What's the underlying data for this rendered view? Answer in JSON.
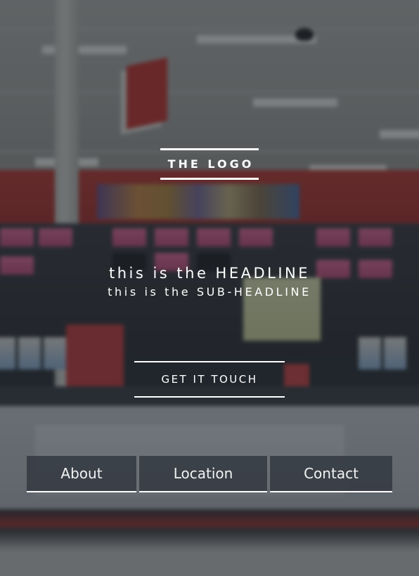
{
  "logo": {
    "text": "THE LOGO"
  },
  "hero": {
    "headline": "this is the HEADLINE",
    "subheadline": "this is the SUB-HEADLINE",
    "cta_label": "GET IT TOUCH"
  },
  "nav": {
    "items": [
      {
        "label": "About"
      },
      {
        "label": "Location"
      },
      {
        "label": "Contact"
      }
    ]
  },
  "colors": {
    "overlay": "#1a2028",
    "text": "#ffffff",
    "nav_background": "#343a42",
    "accent_red": "#c0372f"
  }
}
